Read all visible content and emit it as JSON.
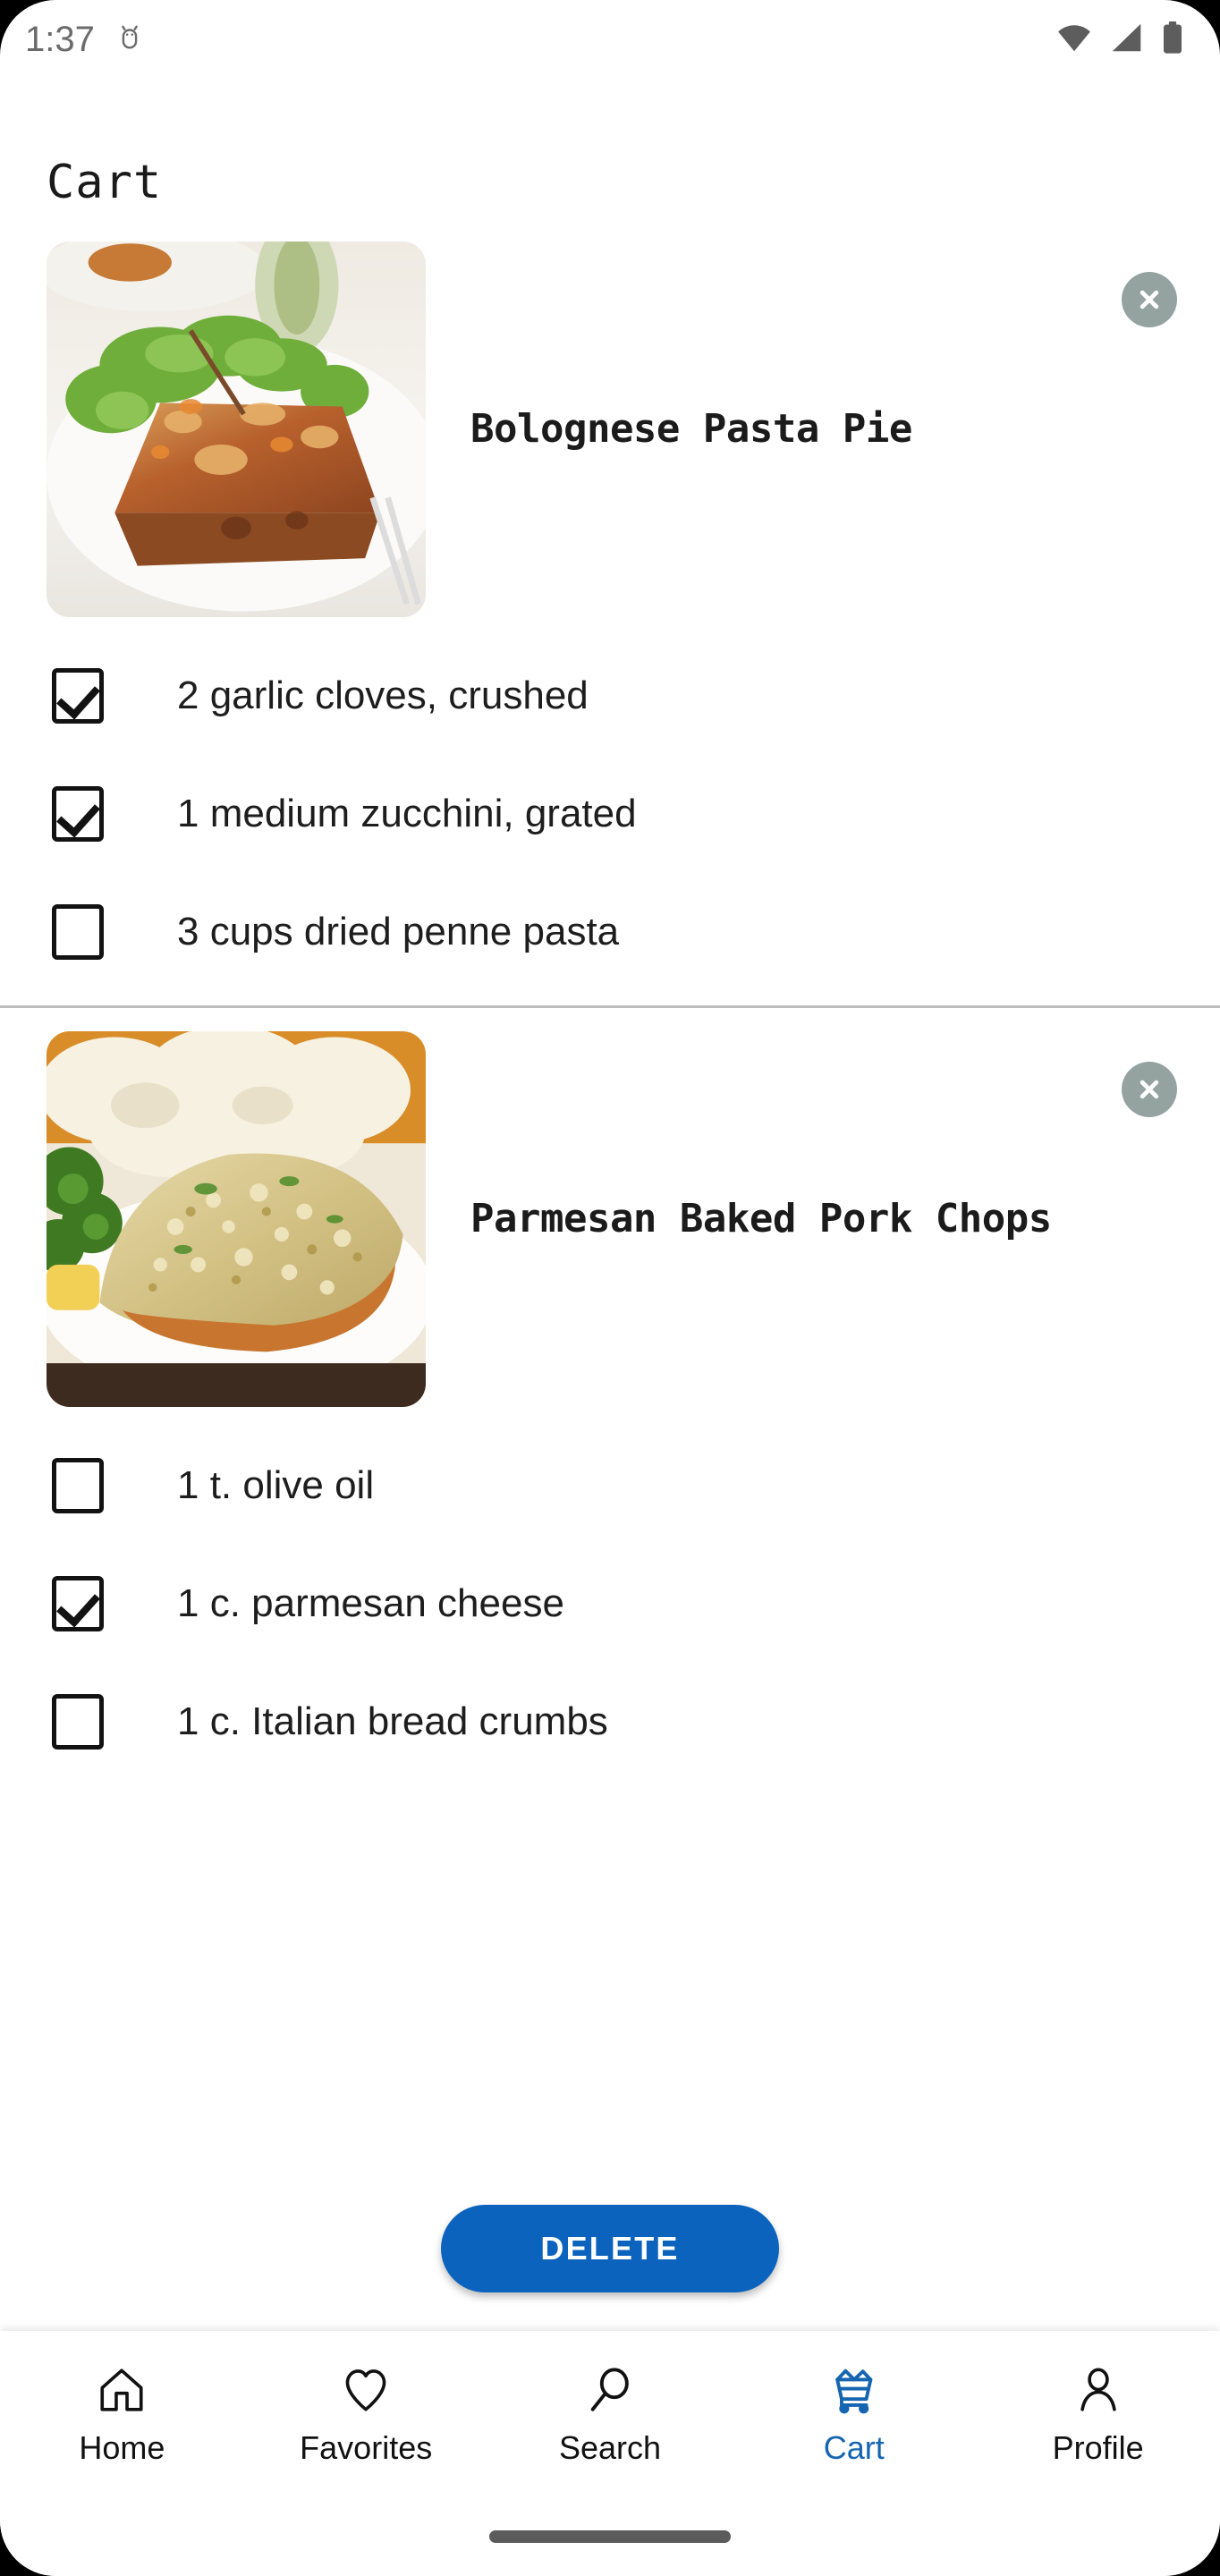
{
  "status_bar": {
    "time": "1:37",
    "icons": [
      "android-debug-icon",
      "wifi-icon",
      "cellular-signal-icon",
      "battery-icon"
    ]
  },
  "header": {
    "title": "Cart"
  },
  "colors": {
    "accent_blue": "#0c63be",
    "nav_active_blue": "#1565b0",
    "remove_button_gray": "#94a3a0",
    "divider_gray": "#bdbdbd"
  },
  "cart": {
    "sections": [
      {
        "recipe_title": "Bolognese Pasta Pie",
        "thumbnail_alt": "bolognese-pasta-pie-photo",
        "remove_label": "remove",
        "ingredients": [
          {
            "text": "2 garlic cloves, crushed",
            "checked": true
          },
          {
            "text": "1 medium zucchini, grated",
            "checked": true
          },
          {
            "text": "3 cups dried penne pasta",
            "checked": false
          }
        ]
      },
      {
        "recipe_title": "Parmesan Baked Pork Chops",
        "thumbnail_alt": "parmesan-baked-pork-chops-photo",
        "remove_label": "remove",
        "ingredients": [
          {
            "text": "1 t. olive oil",
            "checked": false
          },
          {
            "text": "1 c. parmesan cheese",
            "checked": true
          },
          {
            "text": "1 c. Italian bread crumbs",
            "checked": false
          }
        ]
      }
    ]
  },
  "actions": {
    "delete_label": "DELETE"
  },
  "bottom_nav": {
    "items": [
      {
        "label": "Home",
        "icon": "home-icon",
        "active": false
      },
      {
        "label": "Favorites",
        "icon": "heart-icon",
        "active": false
      },
      {
        "label": "Search",
        "icon": "search-icon",
        "active": false
      },
      {
        "label": "Cart",
        "icon": "shopping-cart-icon",
        "active": true
      },
      {
        "label": "Profile",
        "icon": "person-icon",
        "active": false
      }
    ]
  }
}
